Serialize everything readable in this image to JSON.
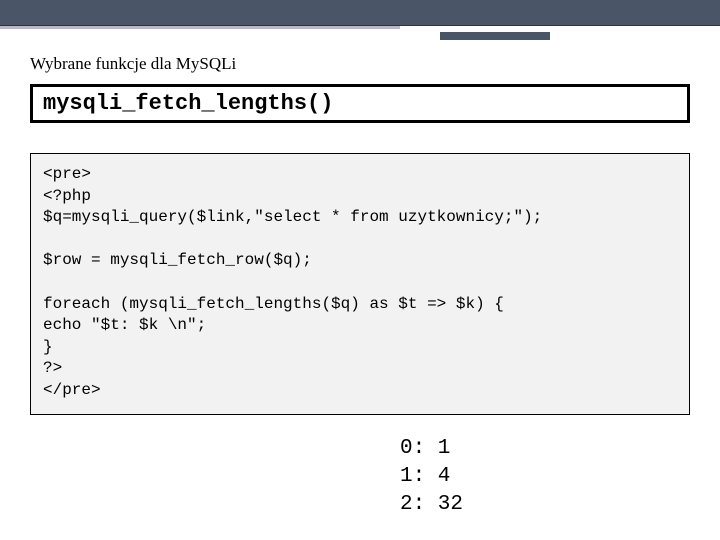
{
  "section_title": "Wybrane funkcje dla MySQLi",
  "function_name": "mysqli_fetch_lengths()",
  "code": "<pre>\n<?php\n$q=mysqli_query($link,\"select * from uzytkownicy;\");\n\n$row = mysqli_fetch_row($q);\n\nforeach (mysqli_fetch_lengths($q) as $t => $k) {\necho \"$t: $k \\n\";\n}\n?>\n</pre>",
  "output": "0: 1\n1: 4\n2: 32"
}
